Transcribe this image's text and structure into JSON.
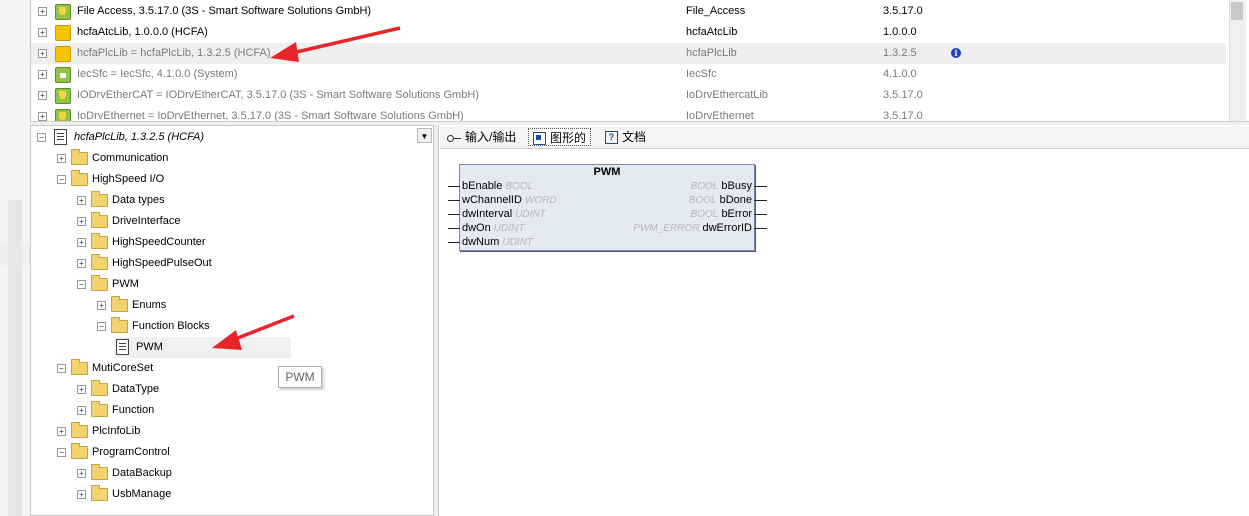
{
  "libraries": [
    {
      "name": "File Access, 3.5.17.0 (3S - Smart Software Solutions GmbH)",
      "namespace": "File_Access",
      "version": "3.5.17.0",
      "icon": "shield-library-icon",
      "dim": false
    },
    {
      "name": "hcfaAtcLib, 1.0.0.0 (HCFA)",
      "namespace": "hcfaAtcLib",
      "version": "1.0.0.0",
      "icon": "yellow-library-icon",
      "dim": false
    },
    {
      "name": "hcfaPlcLib = hcfaPlcLib, 1.3.2.5 (HCFA)",
      "namespace": "hcfaPlcLib",
      "version": "1.3.2.5",
      "icon": "yellow-library-icon",
      "dim": true,
      "selected": true,
      "info": "i"
    },
    {
      "name": "IecSfc = IecSfc, 4.1.0.0 (System)",
      "namespace": "IecSfc",
      "version": "4.1.0.0",
      "icon": "lock-library-icon",
      "dim": true
    },
    {
      "name": "IODrvEtherCAT = IODrvEtherCAT, 3.5.17.0 (3S - Smart Software Solutions GmbH)",
      "namespace": "IoDrvEthercatLib",
      "version": "3.5.17.0",
      "icon": "shield-library-icon",
      "dim": true
    },
    {
      "name": "IoDrvEthernet = IoDrvEthernet, 3.5.17.0 (3S - Smart Software Solutions GmbH)",
      "namespace": "IoDrvEthernet",
      "version": "3.5.17.0",
      "icon": "shield-library-icon",
      "dim": true
    }
  ],
  "tree": {
    "root": "hcfaPlcLib, 1.3.2.5 (HCFA)",
    "nodes": [
      {
        "label": "Communication"
      },
      {
        "label": "HighSpeed I/O"
      },
      {
        "label": "Data types"
      },
      {
        "label": "DriveInterface"
      },
      {
        "label": "HighSpeedCounter"
      },
      {
        "label": "HighSpeedPulseOut"
      },
      {
        "label": "PWM"
      },
      {
        "label": "Enums"
      },
      {
        "label": "Function Blocks"
      },
      {
        "label": "PWM"
      },
      {
        "label": "MutiCoreSet"
      },
      {
        "label": "DataType"
      },
      {
        "label": "Function"
      },
      {
        "label": "PlcInfoLib"
      },
      {
        "label": "ProgramControl"
      },
      {
        "label": "DataBackup"
      },
      {
        "label": "UsbManage"
      }
    ],
    "tooltip": "PWM"
  },
  "tabs": [
    {
      "label": "输入/输出",
      "icon": "io-icon"
    },
    {
      "label": "图形的",
      "icon": "graphic-icon",
      "active": true
    },
    {
      "label": "文档",
      "icon": "help-icon"
    }
  ],
  "function_block": {
    "name": "PWM",
    "inputs": [
      {
        "name": "bEnable",
        "type": "BOOL"
      },
      {
        "name": "wChannelID",
        "type": "WORD"
      },
      {
        "name": "dwInterval",
        "type": "UDINT"
      },
      {
        "name": "dwOn",
        "type": "UDINT"
      },
      {
        "name": "dwNum",
        "type": "UDINT"
      }
    ],
    "outputs": [
      {
        "name": "bBusy",
        "type": "BOOL"
      },
      {
        "name": "bDone",
        "type": "BOOL"
      },
      {
        "name": "bError",
        "type": "BOOL"
      },
      {
        "name": "dwErrorID",
        "type": "PWM_ERROR"
      }
    ]
  },
  "colors": {
    "arrow": "#e8262a",
    "selection": "#efefef",
    "fb_fill": "#e4eaf4"
  }
}
